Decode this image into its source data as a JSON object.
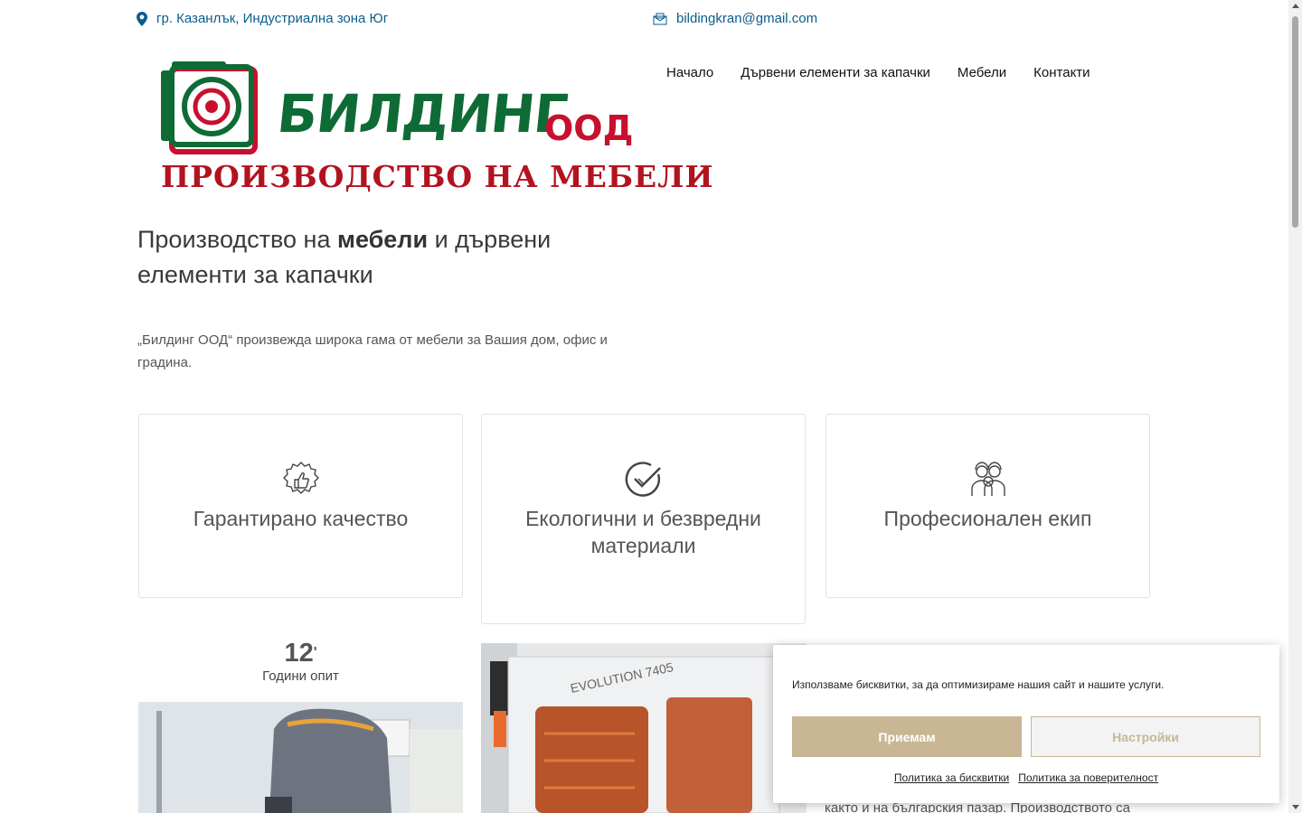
{
  "topbar": {
    "address": "гр. Казанлък, Индустриална зона Юг",
    "email": "bildingkran@gmail.com",
    "address_icon": "map-pin-icon",
    "email_icon": "envelope-icon",
    "accent_color": "#0a5c8c"
  },
  "logo": {
    "name": "БИЛДИНГ",
    "suffix": "ООД",
    "tagline": "ПРОИЗВОДСТВО НА МЕБЕЛИ",
    "colors": {
      "green": "#0e6b35",
      "red": "#c8102e"
    }
  },
  "nav": {
    "items": [
      {
        "label": "Начало"
      },
      {
        "label": "Дървени елементи за капачки"
      },
      {
        "label": "Мебели"
      },
      {
        "label": "Контакти"
      }
    ]
  },
  "hero": {
    "title_part1": "Производство на ",
    "title_bold": "мебели",
    "title_part2": " и дървени елементи за капачки",
    "description": "„Билдинг ООД“ произвежда широка гама от мебели за Вашия дом, офис и градина."
  },
  "features": [
    {
      "title": "Гарантирано качество",
      "icon": "quality-badge-icon"
    },
    {
      "title": "Екологични и безвредни материали",
      "icon": "check-circle-icon"
    },
    {
      "title": "Професионален екип",
      "icon": "team-icon"
    }
  ],
  "counter": {
    "value": "12",
    "suffix": "'",
    "label": "Години опит"
  },
  "partial_text": "както и на българския пазар. Производството са",
  "cookie_banner": {
    "text": "Използваме бисквитки, за да оптимизираме нашия сайт и нашите услуги.",
    "accept_label": "Приемам",
    "settings_label": "Настройки",
    "cookie_policy_label": "Политика за бисквитки",
    "privacy_policy_label": "Политика за поверителност",
    "accent_color": "#c8b694"
  }
}
